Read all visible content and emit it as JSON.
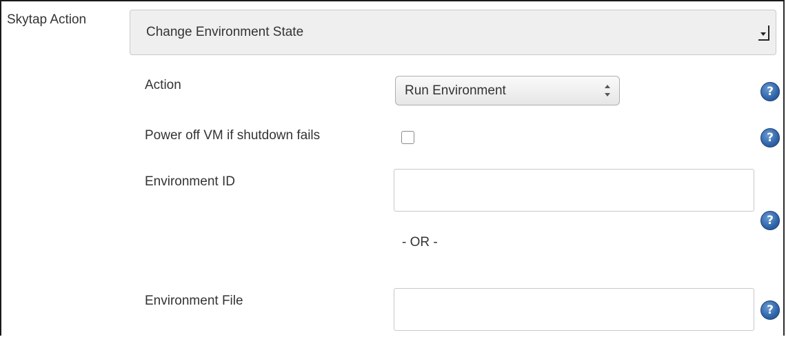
{
  "skytap_action": {
    "label": "Skytap Action",
    "selected": "Change Environment State"
  },
  "action": {
    "label": "Action",
    "selected": "Run Environment"
  },
  "power_off": {
    "label": "Power off VM if shutdown fails",
    "checked": false
  },
  "environment_id": {
    "label": "Environment ID",
    "value": ""
  },
  "or_separator": "- OR -",
  "environment_file": {
    "label": "Environment File",
    "value": ""
  },
  "help_glyph": "?",
  "colors": {
    "help_icon": "#2f64a8",
    "select_bg": "#efefef"
  }
}
